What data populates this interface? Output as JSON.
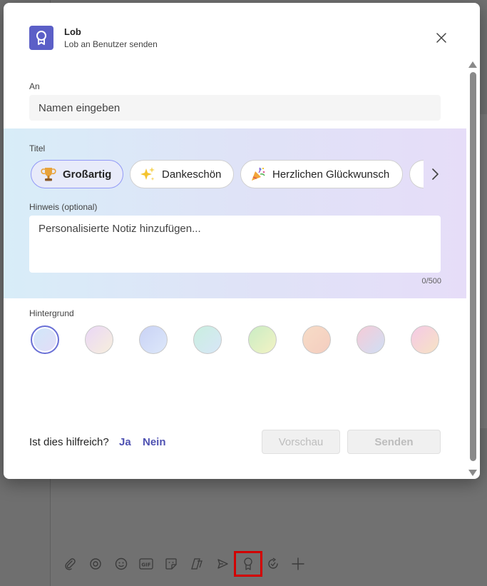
{
  "dialog": {
    "title": "Lob",
    "subtitle": "Lob an Benutzer senden",
    "icon": "badge-icon"
  },
  "to_field": {
    "label": "An",
    "placeholder": "Namen eingeben"
  },
  "title_section": {
    "label": "Titel",
    "chips": [
      {
        "label": "Großartig",
        "icon": "trophy-icon",
        "selected": true
      },
      {
        "label": "Dankeschön",
        "icon": "sparkles-icon",
        "selected": false
      },
      {
        "label": "Herzlichen Glückwunsch",
        "icon": "party-popper-icon",
        "selected": false
      }
    ]
  },
  "note": {
    "label": "Hinweis (optional)",
    "placeholder": "Personalisierte Notiz hinzufügen...",
    "counter": "0/500"
  },
  "background": {
    "label": "Hintergrund",
    "swatches": [
      {
        "name": "blue-lavender",
        "colors": [
          "#cfe8f9",
          "#e4dcf8"
        ],
        "selected": true
      },
      {
        "name": "lilac-cream",
        "colors": [
          "#ead7f7",
          "#f7efdc"
        ],
        "selected": false
      },
      {
        "name": "periwinkle",
        "colors": [
          "#c9d2f5",
          "#dde8fa"
        ],
        "selected": false
      },
      {
        "name": "mint-blue",
        "colors": [
          "#c9efdf",
          "#d8e6f8"
        ],
        "selected": false
      },
      {
        "name": "green-yellow",
        "colors": [
          "#c9ecc4",
          "#f3f3c4"
        ],
        "selected": false
      },
      {
        "name": "peach-orange",
        "colors": [
          "#f7dcc7",
          "#f4cdbf"
        ],
        "selected": false
      },
      {
        "name": "pink-blue",
        "colors": [
          "#f6cbd7",
          "#cfdff5"
        ],
        "selected": false
      },
      {
        "name": "pink-yellow",
        "colors": [
          "#f5c9e6",
          "#f6e3c4"
        ],
        "selected": false
      }
    ]
  },
  "footer": {
    "helpful_question": "Ist dies hilfreich?",
    "yes": "Ja",
    "no": "Nein",
    "preview_button": "Vorschau",
    "send_button": "Senden"
  },
  "toolbar": {
    "icons": [
      "attach-icon",
      "loop-icon",
      "emoji-icon",
      "gif-icon",
      "sticker-icon",
      "loop-components-icon",
      "send-schedule-icon",
      "praise-icon",
      "updates-icon",
      "add-icon"
    ],
    "highlighted": "praise-icon"
  },
  "colors": {
    "accent": "#5b5fc7",
    "link": "#4f52b2",
    "highlight": "#d20000"
  }
}
